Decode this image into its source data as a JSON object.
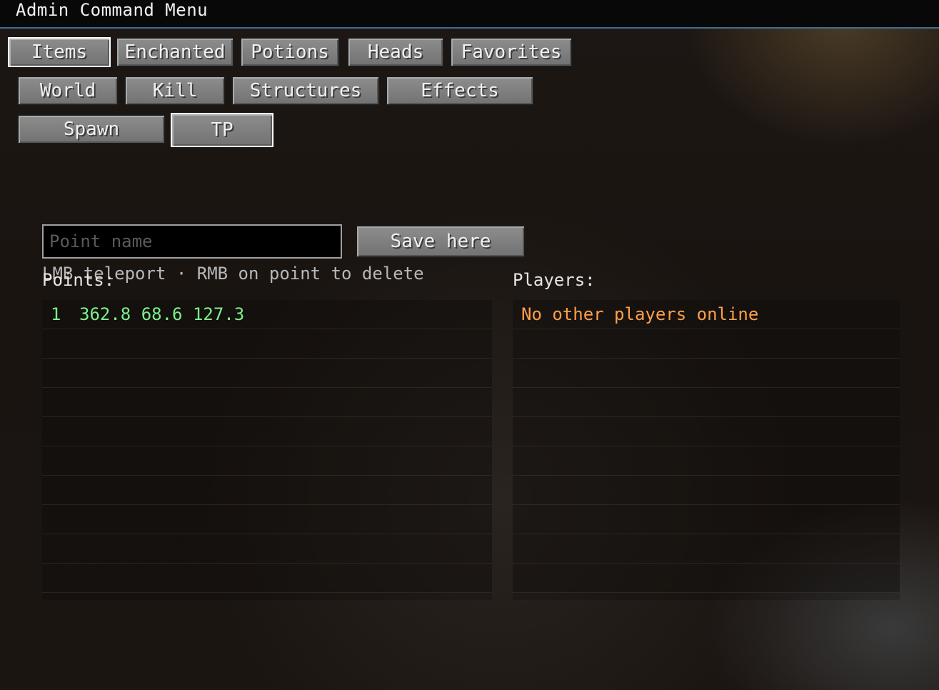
{
  "window": {
    "title": "Admin Command Menu"
  },
  "tabs": [
    {
      "label": "Items",
      "selected": true
    },
    {
      "label": "Enchanted",
      "selected": false
    },
    {
      "label": "Potions",
      "selected": false
    },
    {
      "label": "Heads",
      "selected": false
    },
    {
      "label": "Favorites",
      "selected": false
    },
    {
      "label": "World",
      "selected": false
    },
    {
      "label": "Kill",
      "selected": false
    },
    {
      "label": "Structures",
      "selected": false
    },
    {
      "label": "Effects",
      "selected": false
    },
    {
      "label": "Spawn",
      "selected": false
    },
    {
      "label": "TP",
      "selected": true
    }
  ],
  "tp_panel": {
    "point_name_placeholder": "Point name",
    "point_name_value": "",
    "save_button_label": "Save here",
    "hint": "LMB teleport · RMB on point to delete",
    "points_label": "Points:",
    "players_label": "Players:",
    "points": [
      {
        "index": "1",
        "coords": "362.8 68.6 127.3"
      }
    ],
    "players_empty_message": "No other players online"
  },
  "colors": {
    "title_bar_accent": "#3c6f93",
    "point_text": "#7cf08a",
    "players_empty_text": "#ff9f4a",
    "selected_tab_border": "#ffffff"
  }
}
